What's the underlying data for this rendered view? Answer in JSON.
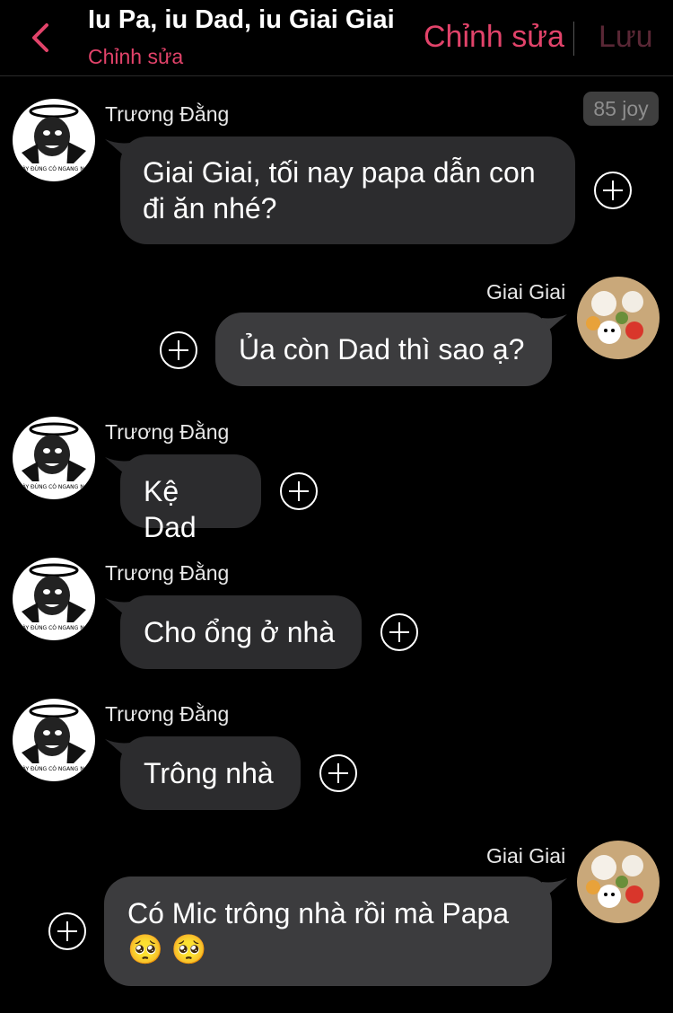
{
  "header": {
    "title": "Iu Pa, iu Dad, iu Giai Giai",
    "subtitle": "Chỉnh sửa",
    "edit_label": "Chỉnh sửa",
    "save_label": "Lưu"
  },
  "joy_badge": "85 joy",
  "messages": [
    {
      "sender": "Trương Đằng",
      "side": "left",
      "text_line1": "Giai Giai, tối nay papa dẫn con",
      "text_line2": "đi ăn nhé?"
    },
    {
      "sender": "Giai Giai",
      "side": "right",
      "text": "Ủa còn Dad thì sao ạ?"
    },
    {
      "sender": "Trương Đằng",
      "side": "left",
      "text": "Kệ Dad"
    },
    {
      "sender": "Trương Đằng",
      "side": "left",
      "text": "Cho ổng ở nhà"
    },
    {
      "sender": "Trương Đằng",
      "side": "left",
      "text": "Trông nhà"
    },
    {
      "sender": "Giai Giai",
      "side": "right",
      "text_line1": "Có Mic trông nhà rồi mà Papa",
      "text_line2": "🥺 🥺"
    }
  ],
  "avatar_caption": "MÀY ĐÙNG CÓ NGANG NG"
}
